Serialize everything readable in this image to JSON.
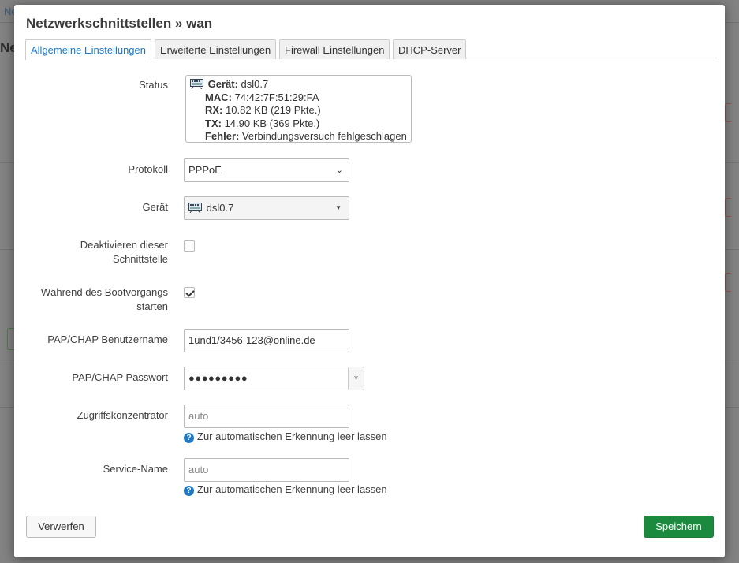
{
  "background": {
    "nav_fragment": "Ne",
    "heading_fragment": "Ne"
  },
  "modal": {
    "title": "Netzwerkschnittstellen » wan",
    "tabs": [
      {
        "label": "Allgemeine Einstellungen",
        "active": true
      },
      {
        "label": "Erweiterte Einstellungen",
        "active": false
      },
      {
        "label": "Firewall Einstellungen",
        "active": false
      },
      {
        "label": "DHCP-Server",
        "active": false
      }
    ],
    "status": {
      "label": "Status",
      "device_key": "Gerät:",
      "device_val": "dsl0.7",
      "mac_key": "MAC:",
      "mac_val": "74:42:7F:51:29:FA",
      "rx_key": "RX:",
      "rx_val": "10.82 KB (219 Pkte.)",
      "tx_key": "TX:",
      "tx_val": "14.90 KB (369 Pkte.)",
      "error_key": "Fehler:",
      "error_val": "Verbindungsversuch fehlgeschlagen"
    },
    "protocol": {
      "label": "Protokoll",
      "value": "PPPoE"
    },
    "device": {
      "label": "Gerät",
      "value": "dsl0.7"
    },
    "disable": {
      "label_line1": "Deaktivieren dieser",
      "label_line2": "Schnittstelle",
      "checked": false
    },
    "boot": {
      "label_line1": "Während des Bootvorgangs",
      "label_line2": "starten",
      "checked": true
    },
    "username": {
      "label": "PAP/CHAP Benutzername",
      "value": "1und1/3456-123@online.de"
    },
    "password": {
      "label": "PAP/CHAP Passwort",
      "value": "●●●●●●●●●",
      "toggle": "*"
    },
    "concentrator": {
      "label": "Zugriffskonzentrator",
      "placeholder": "auto",
      "hint": "Zur automatischen Erkennung leer lassen"
    },
    "service": {
      "label": "Service-Name",
      "placeholder": "auto",
      "hint": "Zur automatischen Erkennung leer lassen"
    },
    "buttons": {
      "dismiss": "Verwerfen",
      "save": "Speichern"
    },
    "colors": {
      "accent": "#1f78c4",
      "save": "#1b8a3f"
    }
  }
}
